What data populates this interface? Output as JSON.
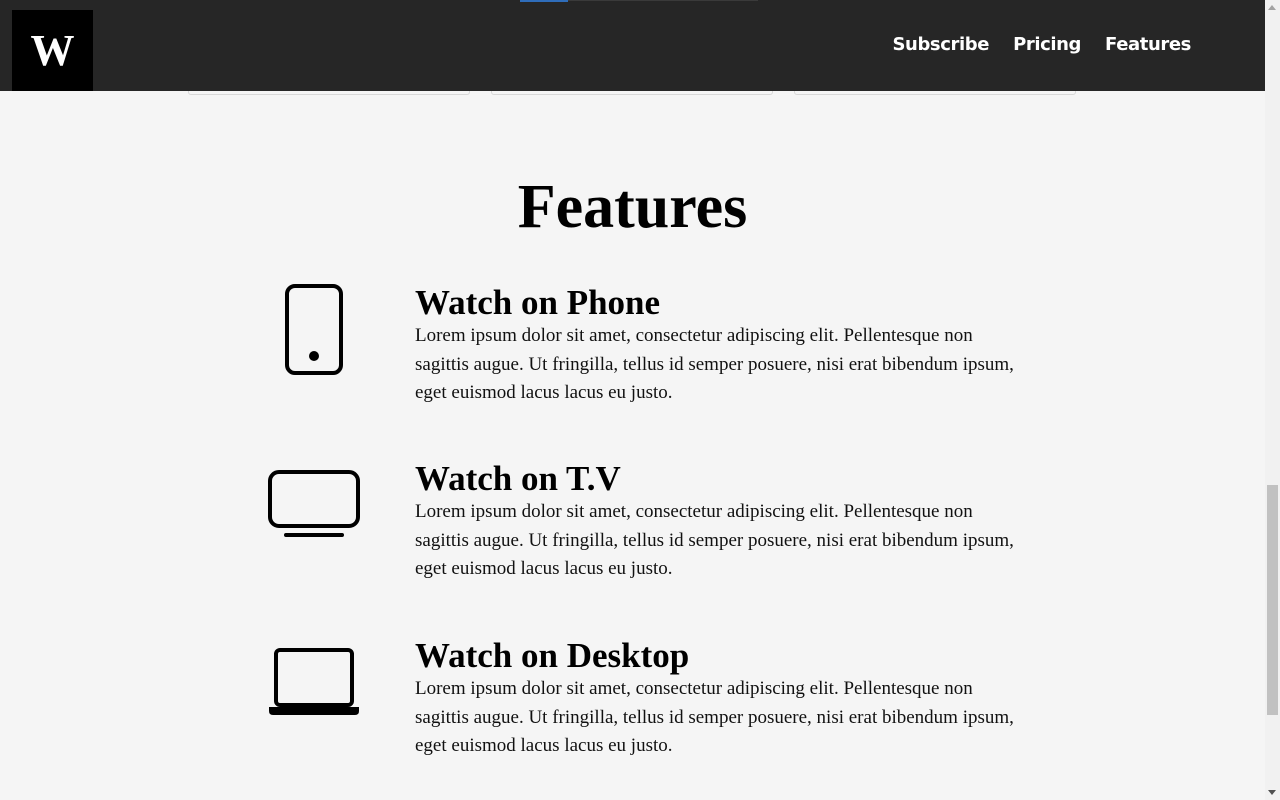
{
  "header": {
    "logo": "W",
    "nav": [
      "Subscribe",
      "Pricing",
      "Features"
    ]
  },
  "features_section": {
    "title": "Features",
    "items": [
      {
        "icon": "phone-icon",
        "title": "Watch on Phone",
        "text": "Lorem ipsum dolor sit amet, consectetur adipiscing elit. Pellentesque non sagittis augue. Ut fringilla, tellus id semper posuere, nisi erat bibendum ipsum, eget euismod lacus lacus eu justo."
      },
      {
        "icon": "tv-icon",
        "title": "Watch on T.V",
        "text": "Lorem ipsum dolor sit amet, consectetur adipiscing elit. Pellentesque non sagittis augue. Ut fringilla, tellus id semper posuere, nisi erat bibendum ipsum, eget euismod lacus lacus eu justo."
      },
      {
        "icon": "laptop-icon",
        "title": "Watch on Desktop",
        "text": "Lorem ipsum dolor sit amet, consectetur adipiscing elit. Pellentesque non sagittis augue. Ut fringilla, tellus id semper posuere, nisi erat bibendum ipsum, eget euismod lacus lacus eu justo."
      }
    ]
  },
  "colors": {
    "header_bg": "#262626",
    "page_bg": "#f5f5f5",
    "accent": "#2f6dba"
  }
}
